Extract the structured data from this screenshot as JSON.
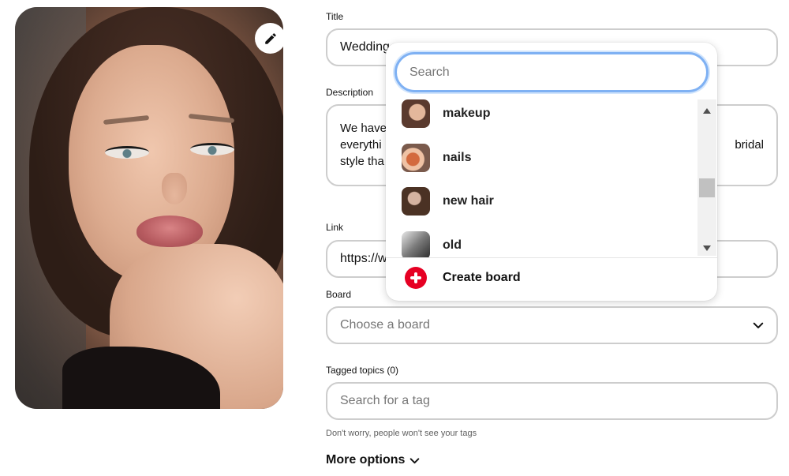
{
  "form": {
    "title_label": "Title",
    "title_value": "Wedding",
    "description_label": "Description",
    "description_line1": "We have",
    "description_line2": "everythi",
    "description_line3": "style tha",
    "description_right2": "bridal",
    "link_label": "Link",
    "link_value": "https://w",
    "board_label": "Board",
    "board_placeholder": "Choose a board",
    "tags_label": "Tagged topics (0)",
    "tags_placeholder": "Search for a tag",
    "tags_hint": "Don't worry, people won't see your tags",
    "more_options": "More options"
  },
  "dropdown": {
    "search_placeholder": "Search",
    "boards": [
      {
        "label": "makeup",
        "icon": "makeup-thumbnail"
      },
      {
        "label": "nails",
        "icon": "nails-thumbnail"
      },
      {
        "label": "new hair",
        "icon": "hair-thumbnail"
      },
      {
        "label": "old",
        "icon": "old-thumbnail"
      }
    ],
    "create_label": "Create board"
  },
  "colors": {
    "accent": "#e60023",
    "focus": "#7fb1f3",
    "border": "#cdcdcd"
  },
  "icons": {
    "edit": "pencil-icon",
    "chevron": "chevron-down-icon",
    "create": "plus-circle-icon"
  }
}
